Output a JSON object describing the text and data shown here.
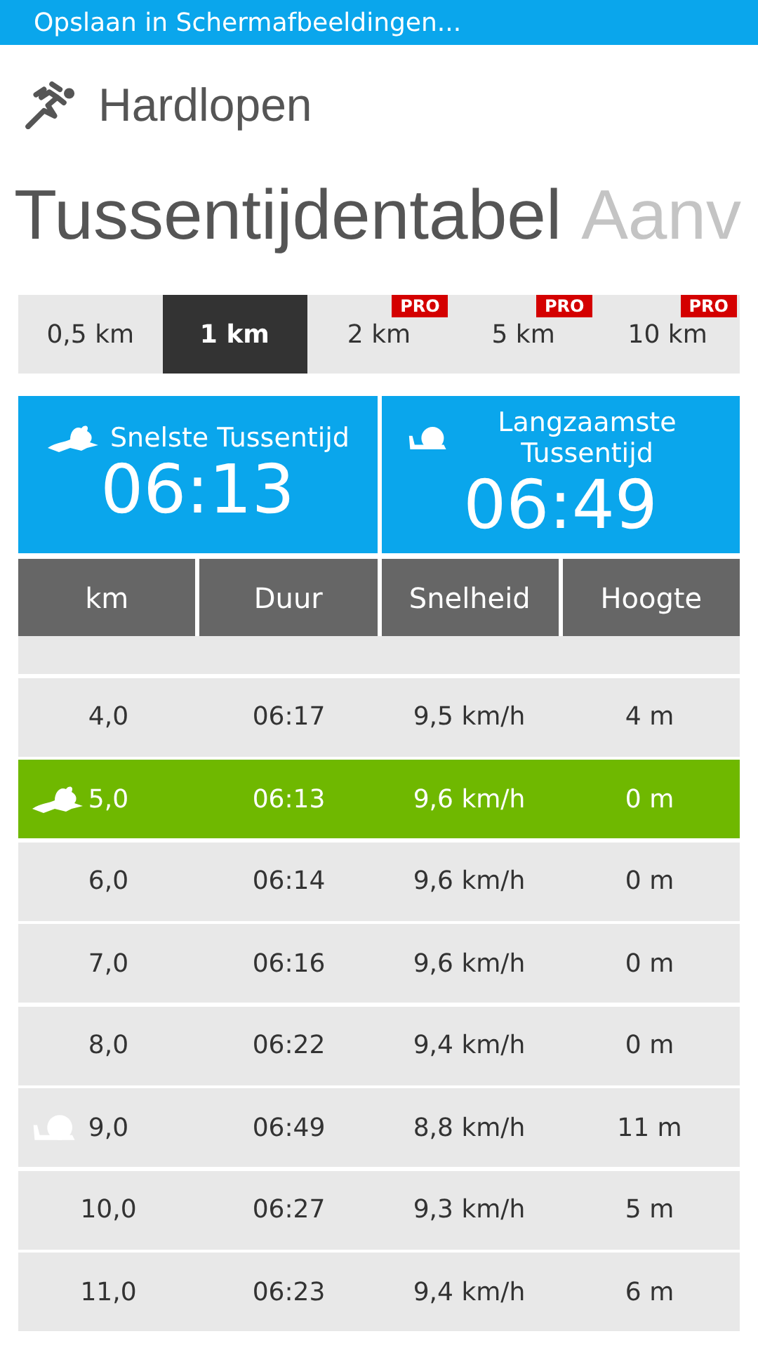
{
  "status_bar": {
    "text": "Opslaan in Schermafbeeldingen..."
  },
  "app": {
    "title": "Hardlopen"
  },
  "pivot": {
    "title": "Tussentijdentabel",
    "next_title": "Aanv"
  },
  "tabs": [
    {
      "label": "0,5 km",
      "selected": false
    },
    {
      "label": "1 km",
      "selected": true
    },
    {
      "label": "2 km",
      "selected": false,
      "badge": "PRO"
    },
    {
      "label": "5 km",
      "selected": false,
      "badge": "PRO"
    },
    {
      "label": "10 km",
      "selected": false,
      "badge": "PRO"
    }
  ],
  "summary": [
    {
      "kind": "fastest",
      "label": "Snelste Tussentijd",
      "value": "06:13"
    },
    {
      "kind": "slowest",
      "label": "Langzaamste Tussentijd",
      "value": "06:49"
    }
  ],
  "table": {
    "columns": [
      "km",
      "Duur",
      "Snelheid",
      "Hoogte"
    ],
    "rows": [
      {
        "kind": "normal",
        "cells": [
          "4,0",
          "06:17",
          "9,5 km/h",
          "4 m"
        ]
      },
      {
        "kind": "fastest",
        "cells": [
          "5,0",
          "06:13",
          "9,6 km/h",
          "0 m"
        ]
      },
      {
        "kind": "normal",
        "cells": [
          "6,0",
          "06:14",
          "9,6 km/h",
          "0 m"
        ]
      },
      {
        "kind": "normal",
        "cells": [
          "7,0",
          "06:16",
          "9,6 km/h",
          "0 m"
        ]
      },
      {
        "kind": "normal",
        "cells": [
          "8,0",
          "06:22",
          "9,4 km/h",
          "0 m"
        ]
      },
      {
        "kind": "slowest",
        "cells": [
          "9,0",
          "06:49",
          "8,8 km/h",
          "11 m"
        ]
      },
      {
        "kind": "normal",
        "cells": [
          "10,0",
          "06:27",
          "9,3 km/h",
          "5 m"
        ]
      },
      {
        "kind": "normal",
        "cells": [
          "11,0",
          "06:23",
          "9,4 km/h",
          "6 m"
        ]
      }
    ]
  }
}
